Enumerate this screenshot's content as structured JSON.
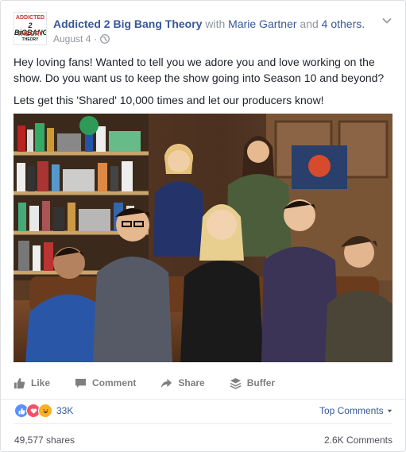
{
  "post": {
    "avatar_lines": [
      "ADDICTED",
      "2 BiGBANG",
      "THEORY",
      "THEORY"
    ],
    "page_name": "Addicted 2 Big Bang Theory",
    "with_text": " with ",
    "tagged_person": "Marie Gartner",
    "and_text": " and ",
    "others": "4 others.",
    "date": "August 4",
    "date_separator": "·",
    "paragraphs": [
      "Hey loving fans! Wanted to tell you we adore you and love working on the show. Do you want us to keep the show going into Season 10 and beyond?",
      "Lets get this 'Shared' 10,000 times and let our producers know!"
    ]
  },
  "actions": {
    "like": "Like",
    "comment": "Comment",
    "share": "Share",
    "buffer": "Buffer"
  },
  "stats": {
    "reaction_count": "33K",
    "top_comments": "Top Comments",
    "shares": "49,577 shares",
    "comments": "2.6K Comments"
  },
  "colors": {
    "link": "#365899",
    "like_blue": "#5890ff",
    "love_red": "#f25268",
    "haha_yellow": "#f7b125"
  },
  "icons": [
    "globe-icon",
    "chevron-down-icon",
    "like-icon",
    "comment-icon",
    "share-icon",
    "buffer-icon"
  ]
}
